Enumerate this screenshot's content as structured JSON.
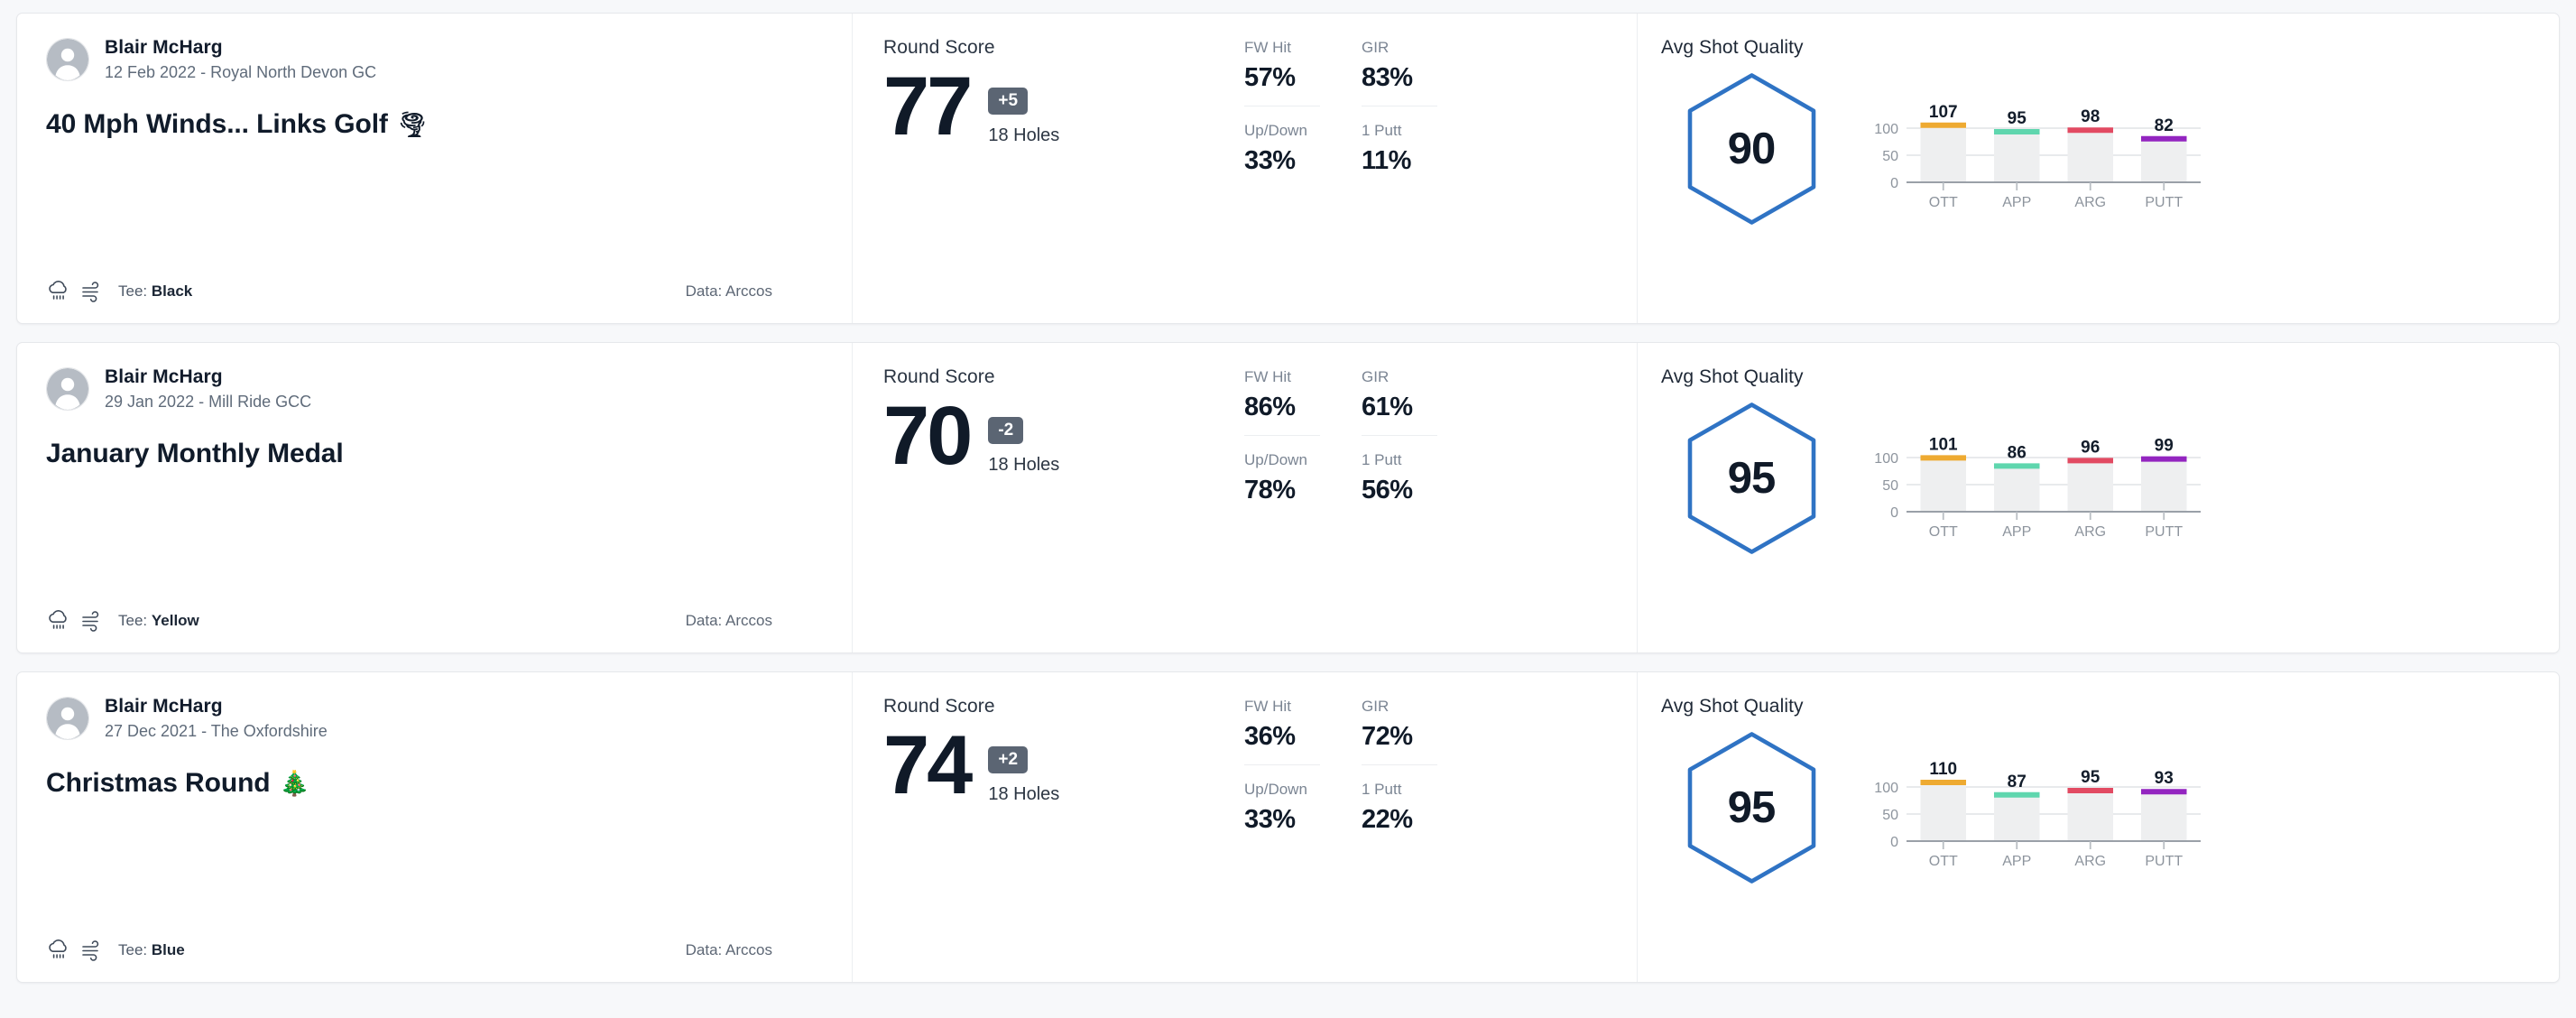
{
  "labels": {
    "round_score": "Round Score",
    "holes": "18 Holes",
    "fw_hit": "FW Hit",
    "gir": "GIR",
    "up_down": "Up/Down",
    "one_putt": "1 Putt",
    "avg_shot_quality": "Avg Shot Quality",
    "tee_prefix": "Tee: ",
    "data_source": "Data: Arccos"
  },
  "colors": {
    "hexagon": "#2f73c4",
    "score_badge_bg": "#5b6573",
    "ott": "#eeaa31",
    "app": "#5fd6ae",
    "arg": "#e24a62",
    "putt": "#9325c0",
    "bar_bg": "#eeeff0"
  },
  "chart_axis": {
    "y_ticks": [
      "100",
      "50",
      "0"
    ],
    "y_values": [
      100,
      50,
      0
    ],
    "ylim": [
      0,
      125
    ],
    "categories": [
      "OTT",
      "APP",
      "ARG",
      "PUTT"
    ]
  },
  "rounds": [
    {
      "player": "Blair McHarg",
      "date_course": "12 Feb 2022 - Royal North Devon GC",
      "title": "40 Mph Winds... Links Golf",
      "title_emoji": "🌪",
      "weather_icon": "rain-cloud-icon",
      "wind_icon": "wind-icon",
      "tee": "Black",
      "data_source": "Data: Arccos",
      "score": "77",
      "diff": "+5",
      "holes": "18 Holes",
      "stats": {
        "fw_hit": "57%",
        "gir": "83%",
        "up_down": "33%",
        "one_putt": "11%"
      },
      "avg_shot_quality": "90",
      "chart_data": {
        "type": "bar",
        "title": "Avg Shot Quality",
        "categories": [
          "OTT",
          "APP",
          "ARG",
          "PUTT"
        ],
        "values": [
          107,
          95,
          98,
          82
        ],
        "colors": [
          "#eeaa31",
          "#5fd6ae",
          "#e24a62",
          "#9325c0"
        ],
        "xlabel": "",
        "ylabel": "",
        "ylim": [
          0,
          125
        ],
        "yticks": [
          0,
          50,
          100
        ],
        "grid": true,
        "legend": "none"
      }
    },
    {
      "player": "Blair McHarg",
      "date_course": "29 Jan 2022 - Mill Ride GCC",
      "title": "January Monthly Medal",
      "title_emoji": "",
      "weather_icon": "rain-cloud-icon",
      "wind_icon": "wind-icon",
      "tee": "Yellow",
      "data_source": "Data: Arccos",
      "score": "70",
      "diff": "-2",
      "holes": "18 Holes",
      "stats": {
        "fw_hit": "86%",
        "gir": "61%",
        "up_down": "78%",
        "one_putt": "56%"
      },
      "avg_shot_quality": "95",
      "chart_data": {
        "type": "bar",
        "title": "Avg Shot Quality",
        "categories": [
          "OTT",
          "APP",
          "ARG",
          "PUTT"
        ],
        "values": [
          101,
          86,
          96,
          99
        ],
        "colors": [
          "#eeaa31",
          "#5fd6ae",
          "#e24a62",
          "#9325c0"
        ],
        "xlabel": "",
        "ylabel": "",
        "ylim": [
          0,
          125
        ],
        "yticks": [
          0,
          50,
          100
        ],
        "grid": true,
        "legend": "none"
      }
    },
    {
      "player": "Blair McHarg",
      "date_course": "27 Dec 2021 - The Oxfordshire",
      "title": "Christmas Round",
      "title_emoji": "🎄",
      "weather_icon": "rain-cloud-icon",
      "wind_icon": "wind-icon",
      "tee": "Blue",
      "data_source": "Data: Arccos",
      "score": "74",
      "diff": "+2",
      "holes": "18 Holes",
      "stats": {
        "fw_hit": "36%",
        "gir": "72%",
        "up_down": "33%",
        "one_putt": "22%"
      },
      "avg_shot_quality": "95",
      "chart_data": {
        "type": "bar",
        "title": "Avg Shot Quality",
        "categories": [
          "OTT",
          "APP",
          "ARG",
          "PUTT"
        ],
        "values": [
          110,
          87,
          95,
          93
        ],
        "colors": [
          "#eeaa31",
          "#5fd6ae",
          "#e24a62",
          "#9325c0"
        ],
        "xlabel": "",
        "ylabel": "",
        "ylim": [
          0,
          125
        ],
        "yticks": [
          0,
          50,
          100
        ],
        "grid": true,
        "legend": "none"
      }
    }
  ]
}
